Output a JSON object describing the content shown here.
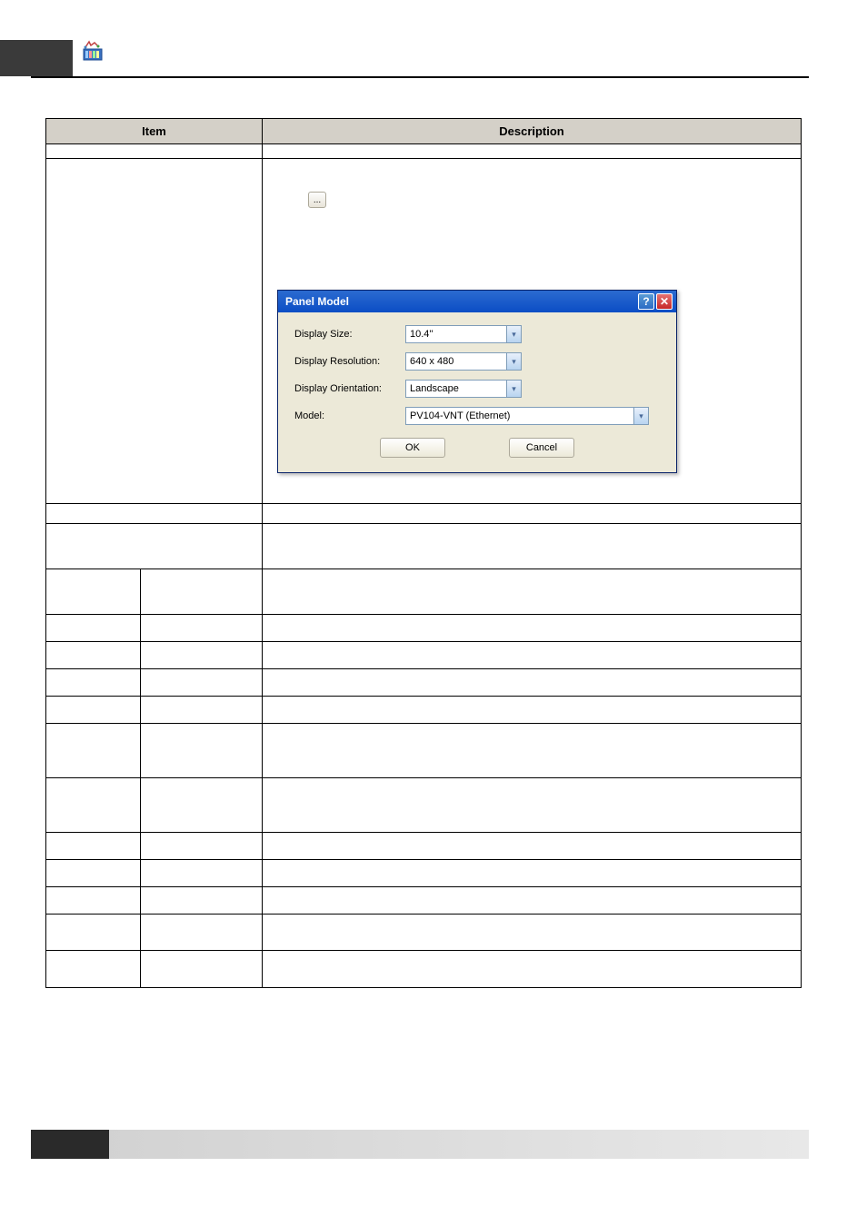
{
  "table": {
    "headers": {
      "item": "Item",
      "description": "Description"
    }
  },
  "dialog": {
    "title": "Panel Model",
    "fields": {
      "display_size": {
        "label": "Display Size:",
        "value": "10.4''"
      },
      "display_resolution": {
        "label": "Display Resolution:",
        "value": "640 x 480"
      },
      "display_orientation": {
        "label": "Display Orientation:",
        "value": "Landscape"
      },
      "model": {
        "label": "Model:",
        "value": "PV104-VNT (Ethernet)"
      }
    },
    "ok_label": "OK",
    "cancel_label": "Cancel"
  },
  "browse_button_label": "...",
  "titlebar_buttons": {
    "help": "?",
    "close": "✕"
  },
  "dropdown_arrow": "▾"
}
